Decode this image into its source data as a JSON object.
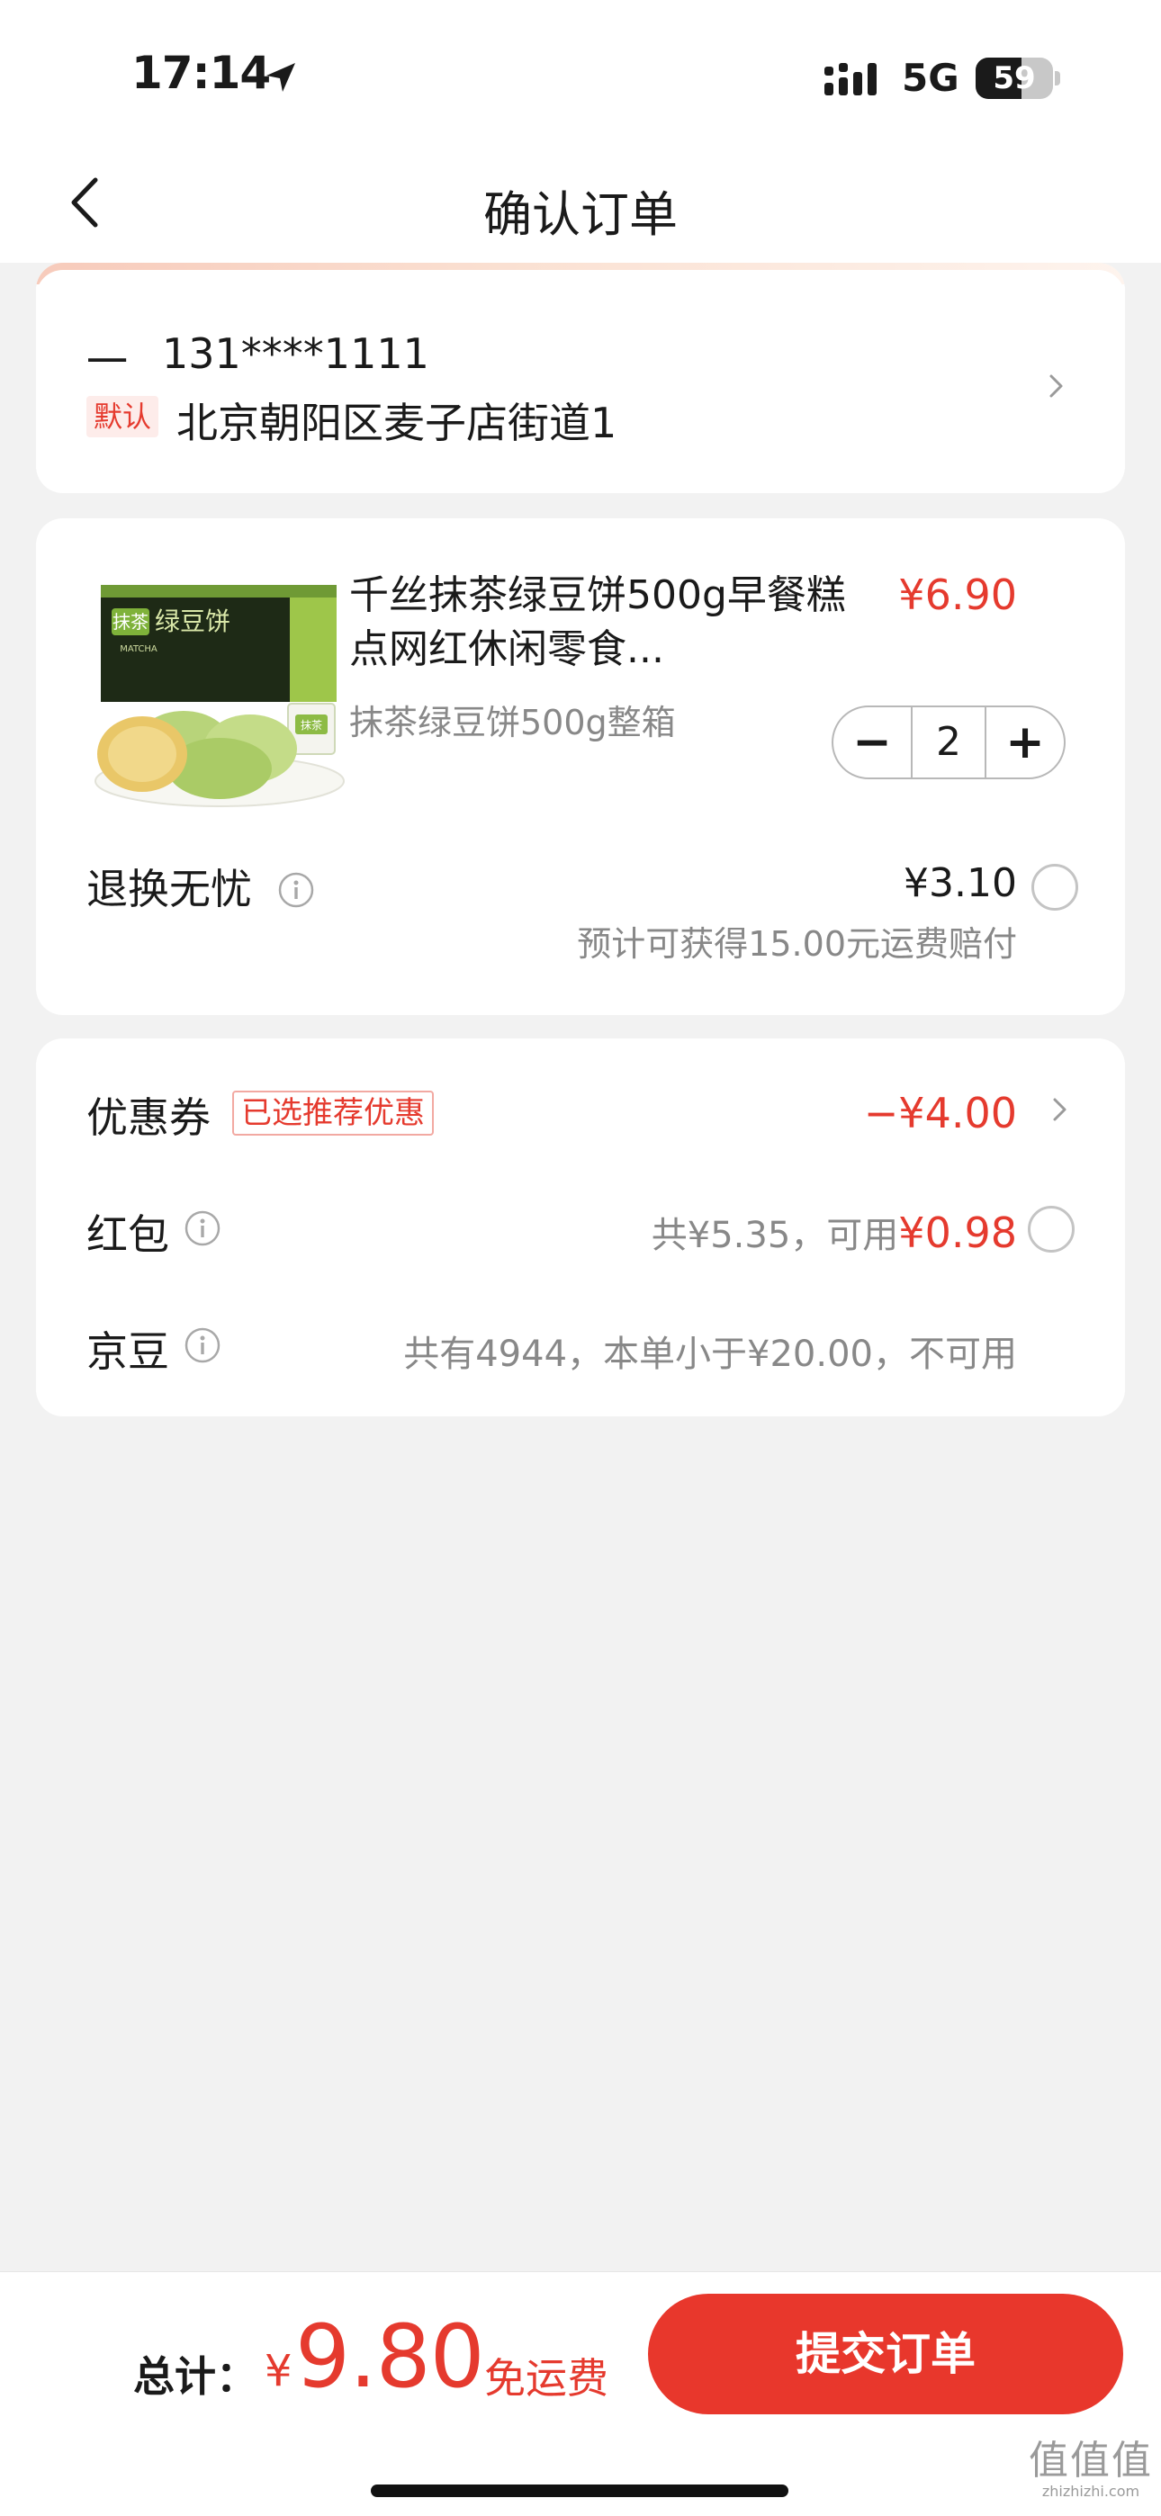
{
  "status_bar": {
    "time": "17:14",
    "network": "5G",
    "battery": "59",
    "battery_level": 0.59,
    "icons": [
      "location-arrow-icon",
      "signal-bars-icon",
      "battery-icon"
    ]
  },
  "nav": {
    "title": "确认订单",
    "back_icon": "chevron-left-icon"
  },
  "address": {
    "name": "一",
    "phone": "131****1111",
    "default_tag": "默认",
    "text": "北京朝阳区麦子店街道1"
  },
  "product": {
    "title": "千丝抹茶绿豆饼500g早餐糕点网红休闲零食...",
    "price": "¥6.90",
    "spec": "抹茶绿豆饼500g整箱",
    "quantity": "2",
    "minus_symbol": "−",
    "plus_symbol": "+",
    "image_text": {
      "brand_tag": "抹茶",
      "box_label": "MATCHA",
      "box_title": "绿豆饼",
      "small_pack": "抹茶"
    }
  },
  "return_service": {
    "label": "退换无忧",
    "price": "¥3.10",
    "note": "预计可获得15.00元运费赔付"
  },
  "discounts": {
    "coupon": {
      "label": "优惠券",
      "tag": "已选推荐优惠",
      "amount": "−¥4.00"
    },
    "red_packet": {
      "label": "红包",
      "prefix": "共¥5.35，可用",
      "available": "¥0.98"
    },
    "jingdou": {
      "label": "京豆",
      "text": "共有4944，本单小于¥20.00，不可用"
    }
  },
  "footer": {
    "total_label": "总计：",
    "currency": "¥",
    "total": "9.80",
    "shipping": "免运费",
    "submit": "提交订单",
    "watermark_logo": "值值值",
    "watermark_url": "zhizhizhi.com"
  },
  "colors": {
    "accent_red": "#e53a2e",
    "submit_button": "#e8372c",
    "background": "#f2f2f2"
  }
}
